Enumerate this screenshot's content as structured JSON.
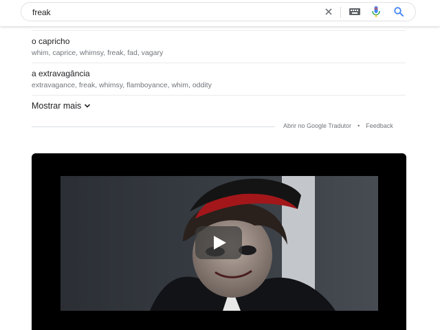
{
  "search": {
    "query": "freak"
  },
  "results": [
    {
      "term": "o capricho",
      "synonyms": "whim, caprice, whimsy, freak, fad, vagary"
    },
    {
      "term": "a extravagância",
      "synonyms": "extravagance, freak, whimsy, flamboyance, whim, oddity"
    }
  ],
  "show_more_label": "Mostrar mais",
  "footer": {
    "translate_link": "Abrir no Google Tradutor",
    "separator": "•",
    "feedback_link": "Feedback"
  },
  "colors": {
    "mic_blue": "#4285f4",
    "mic_red": "#ea4335",
    "mic_green": "#34a853",
    "mic_yellow": "#fbbc05",
    "search_blue": "#4285f4"
  },
  "icons": {
    "clear": "close-icon",
    "keyboard": "keyboard-icon",
    "voice": "mic-icon",
    "search": "search-icon",
    "expand": "chevron-down-icon",
    "play": "play-icon"
  }
}
